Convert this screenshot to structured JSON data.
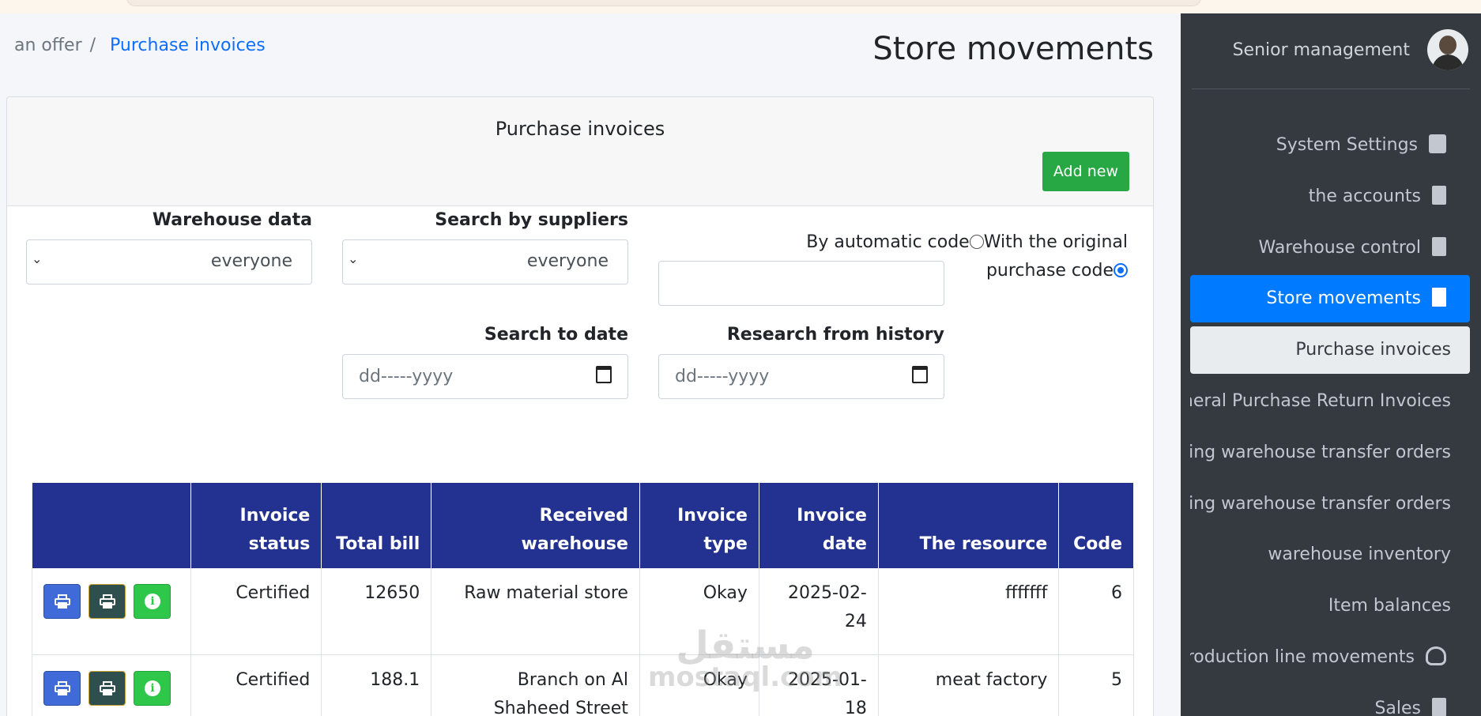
{
  "breadcrumb": {
    "root": "an offer",
    "separator": "/",
    "current": "Purchase invoices"
  },
  "page_title": "Store movements",
  "card": {
    "title": "Purchase invoices",
    "add_button": "Add new"
  },
  "filters": {
    "warehouse": {
      "label": "Warehouse data",
      "value": "everyone"
    },
    "suppliers": {
      "label": "Search by suppliers",
      "value": "everyone"
    },
    "code_mode": {
      "option_auto": "By automatic code",
      "option_original": "With the original purchase code",
      "selected": "original"
    },
    "code_input": {
      "value": ""
    },
    "date_to": {
      "label": "Search to date",
      "placeholder": "dd-----yyyy"
    },
    "date_from": {
      "label": "Research from history",
      "placeholder": "dd-----yyyy"
    }
  },
  "table": {
    "headers": [
      "",
      "Invoice status",
      "Total bill",
      "Received warehouse",
      "Invoice type",
      "Invoice date",
      "The resource",
      "Code"
    ],
    "rows": [
      {
        "status": "Certified",
        "total": "12650",
        "warehouse": "Raw material store",
        "type": "Okay",
        "date": "2025-02-24",
        "resource": "fffffff",
        "code": "6"
      },
      {
        "status": "Certified",
        "total": "188.1",
        "warehouse": "Branch on Al Shaheed Street",
        "type": "Okay",
        "date": "2025-01-18",
        "resource": "meat factory",
        "code": "5"
      }
    ]
  },
  "watermark": {
    "line1": "مستقل",
    "line2": "mostaql.com"
  },
  "sidebar": {
    "user_name": "Senior management",
    "items": [
      {
        "label": "System Settings",
        "icon": "wallet-icon"
      },
      {
        "label": "the accounts",
        "icon": "invoice-dollar-icon"
      },
      {
        "label": "Warehouse control",
        "icon": "file-chart-icon"
      },
      {
        "label": "Store movements",
        "icon": "receipt-icon",
        "active": true
      },
      {
        "label": "Purchase invoices",
        "sub": true
      },
      {
        "label": "General Purchase Return Invoices",
        "sub": true
      },
      {
        "label": "Outgoing warehouse transfer orders",
        "sub": true
      },
      {
        "label": "Incoming warehouse transfer orders",
        "sub": true
      },
      {
        "label": "warehouse inventory",
        "sub": true
      },
      {
        "label": "Item balances",
        "sub": true
      },
      {
        "label": "Production line movements",
        "icon": "gauge-icon"
      },
      {
        "label": "Sales",
        "icon": "file-invoice-icon"
      }
    ]
  },
  "colors": {
    "primary": "#007bff",
    "table_header": "#233290",
    "success": "#28a745",
    "sidebar": "#343a40"
  }
}
